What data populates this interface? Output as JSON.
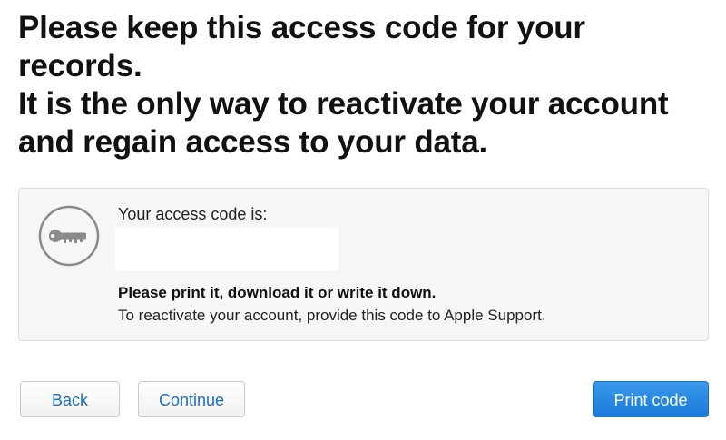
{
  "heading": {
    "line1": "Please keep this access code for your",
    "line2": "records.",
    "line3": "It is the only way to reactivate your account",
    "line4": "and regain access to your data."
  },
  "code_box": {
    "label": "Your access code is:",
    "code_value": "",
    "instruction_bold": "Please print it, download it or write it down.",
    "instruction_text": "To reactivate your account, provide this code to Apple Support.",
    "icon": "key-icon"
  },
  "buttons": {
    "back_label": "Back",
    "continue_label": "Continue",
    "print_label": "Print code"
  },
  "colors": {
    "link_blue": "#1a6fc4",
    "primary_blue": "#1a7ad8",
    "box_background": "#f6f6f6"
  }
}
